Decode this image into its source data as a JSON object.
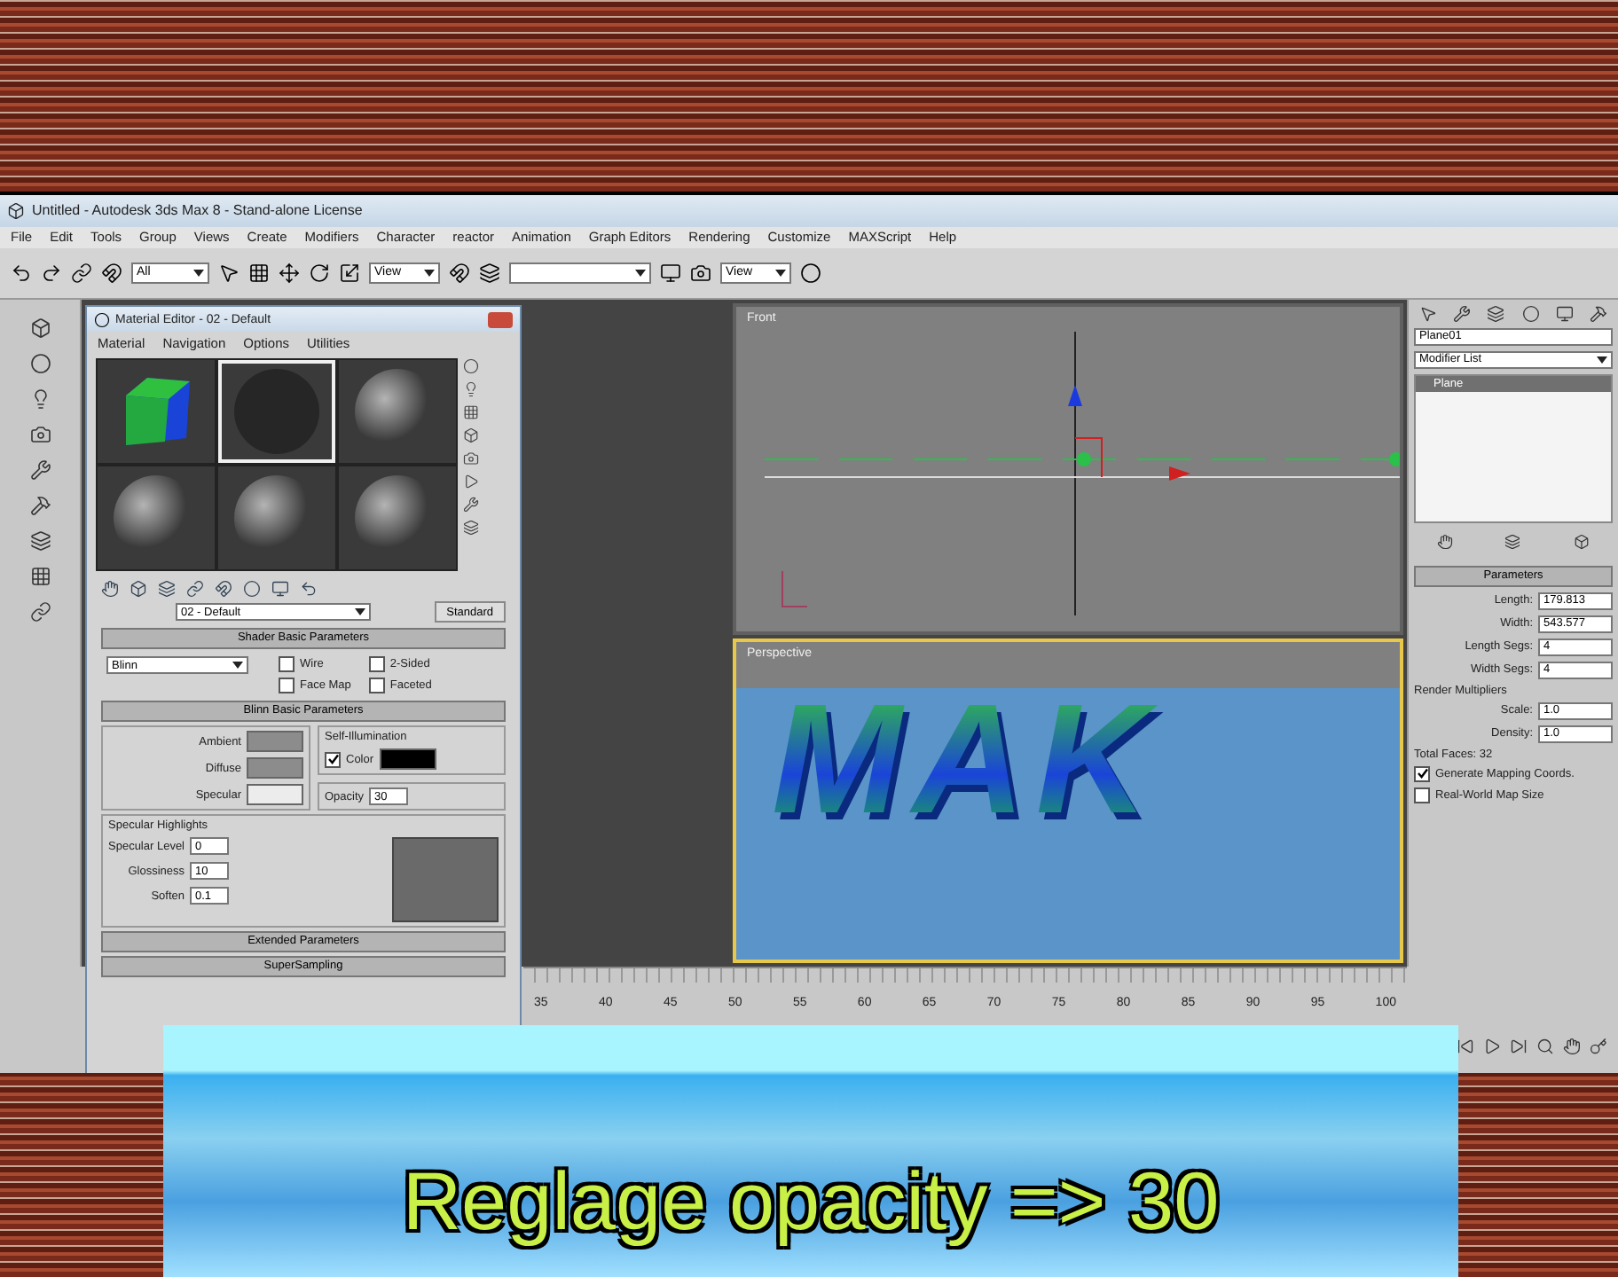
{
  "window": {
    "title": "Untitled - Autodesk 3ds Max 8 - Stand-alone License"
  },
  "menu": [
    "File",
    "Edit",
    "Tools",
    "Group",
    "Views",
    "Create",
    "Modifiers",
    "Character",
    "reactor",
    "Animation",
    "Graph Editors",
    "Rendering",
    "Customize",
    "MAXScript",
    "Help"
  ],
  "toolbar": {
    "selection_filter": "All",
    "reference_coord": "View",
    "view_dropdown": "View"
  },
  "material_editor": {
    "title": "Material Editor - 02 - Default",
    "menu": [
      "Material",
      "Navigation",
      "Options",
      "Utilities"
    ],
    "slots": [
      {
        "kind": "cube",
        "selected": false
      },
      {
        "kind": "dark",
        "selected": true
      },
      {
        "kind": "sphere",
        "selected": false
      },
      {
        "kind": "sphere",
        "selected": false
      },
      {
        "kind": "sphere",
        "selected": false
      },
      {
        "kind": "sphere",
        "selected": false
      }
    ],
    "material_name": "02 - Default",
    "material_type": "Standard",
    "shader": {
      "title": "Shader Basic Parameters",
      "value": "Blinn",
      "options": [
        {
          "label": "Wire",
          "checked": false
        },
        {
          "label": "2-Sided",
          "checked": false
        },
        {
          "label": "Face Map",
          "checked": false
        },
        {
          "label": "Faceted",
          "checked": false
        }
      ]
    },
    "blinn": {
      "title": "Blinn Basic Parameters",
      "colors": [
        {
          "label": "Ambient",
          "color": "#8c8c8c"
        },
        {
          "label": "Diffuse",
          "color": "#8c8c8c"
        },
        {
          "label": "Specular",
          "color": "#ececec"
        }
      ],
      "self_illum": {
        "title": "Self-Illumination",
        "label": "Color",
        "checked": true,
        "color": "#000000"
      },
      "opacity": {
        "label": "Opacity",
        "value": "30"
      }
    },
    "highlights": {
      "title": "Specular Highlights",
      "fields": [
        {
          "label": "Specular Level",
          "value": "0"
        },
        {
          "label": "Glossiness",
          "value": "10"
        },
        {
          "label": "Soften",
          "value": "0.1"
        }
      ]
    },
    "rollouts": [
      "Extended Parameters",
      "SuperSampling"
    ]
  },
  "viewports": [
    {
      "label": "Front",
      "active": false
    },
    {
      "label": "Perspective",
      "active": true,
      "scene_text": "MAK"
    }
  ],
  "command_panel": {
    "object_name": "Plane01",
    "modifier_list": "Modifier List",
    "stack": [
      {
        "label": "Plane",
        "selected": true
      }
    ],
    "rollout": "Parameters",
    "fields": [
      {
        "label": "Length:",
        "value": "179.813"
      },
      {
        "label": "Width:",
        "value": "543.577"
      },
      {
        "label": "Length Segs:",
        "value": "4"
      },
      {
        "label": "Width Segs:",
        "value": "4"
      }
    ],
    "group": "Render Multipliers",
    "group_fields": [
      {
        "label": "Scale:",
        "value": "1.0"
      },
      {
        "label": "Density:",
        "value": "1.0"
      }
    ],
    "total_faces": "Total Faces: 32",
    "checks": [
      {
        "label": "Generate Mapping Coords.",
        "checked": true
      },
      {
        "label": "Real-World Map Size",
        "checked": false
      }
    ]
  },
  "timeline": {
    "ticks": [
      "35",
      "40",
      "45",
      "50",
      "55",
      "60",
      "65",
      "70",
      "75",
      "80",
      "85",
      "90",
      "95",
      "100"
    ]
  },
  "caption": "Reglage opacity => 30"
}
